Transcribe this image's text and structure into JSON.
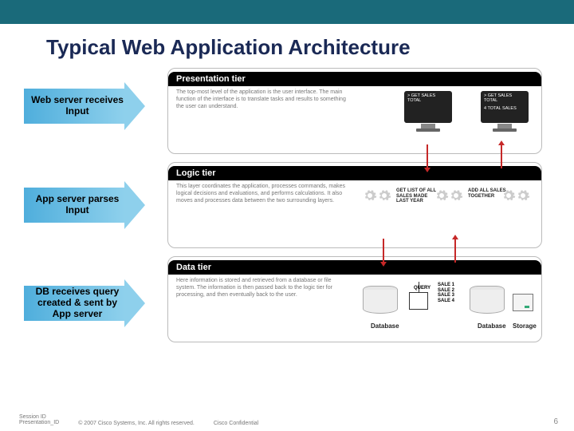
{
  "title": "Typical Web Application Architecture",
  "arrows": {
    "a1": "Web server receives Input",
    "a2": "App server parses Input",
    "a3": "DB receives query created & sent by App server"
  },
  "tiers": {
    "presentation": {
      "title": "Presentation tier",
      "desc": "The top-most level of the application is the user interface. The main function of the interface is to translate tasks and results to something the user can understand.",
      "monitor1_line1": "> GET SALES",
      "monitor1_line2": "TOTAL",
      "monitor2_line1": "> GET SALES",
      "monitor2_line2": "TOTAL",
      "monitor2_line3": "4 TOTAL SALES"
    },
    "logic": {
      "title": "Logic tier",
      "desc": "This layer coordinates the application, processes commands, makes logical decisions and evaluations, and performs calculations. It also moves and processes data between the two surrounding layers.",
      "label1": "GET LIST OF ALL SALES MADE LAST YEAR",
      "label2": "ADD ALL SALES TOGETHER"
    },
    "data": {
      "title": "Data tier",
      "desc": "Here information is stored and retrieved from a database or file system. The information is then passed back to the logic tier for processing, and then eventually back to the user.",
      "db_label": "Database",
      "storage_label": "Storage",
      "query": "QUERY",
      "sales": "SALE 1\nSALE 2\nSALE 3\nSALE 4"
    }
  },
  "footer": {
    "session": "Session ID\nPresentation_ID",
    "copyright": "© 2007 Cisco Systems, Inc. All rights reserved.",
    "confidential": "Cisco Confidential",
    "page": "6"
  }
}
